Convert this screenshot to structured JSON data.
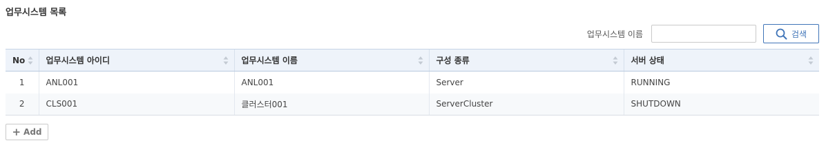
{
  "page": {
    "title": "업무시스템 목록"
  },
  "search": {
    "label": "업무시스템 이름",
    "value": "",
    "placeholder": "",
    "button_label": "검색",
    "button_icon": "search-icon"
  },
  "table": {
    "columns": [
      {
        "label": "No",
        "sort_icon": "sort-icon"
      },
      {
        "label": "업무시스템 아이디",
        "sort_icon": "sort-icon"
      },
      {
        "label": "업무시스템 이름",
        "sort_icon": "sort-icon"
      },
      {
        "label": "구성 종류",
        "sort_icon": "sort-icon"
      },
      {
        "label": "서버 상태",
        "sort_icon": "sort-icon"
      }
    ],
    "rows": [
      {
        "no": "1",
        "id": "ANL001",
        "name": "ANL001",
        "type": "Server",
        "status": "RUNNING"
      },
      {
        "no": "2",
        "id": "CLS001",
        "name": "클러스터001",
        "type": "ServerCluster",
        "status": "SHUTDOWN"
      }
    ]
  },
  "actions": {
    "add_label": "Add",
    "add_icon": "plus-icon"
  },
  "colors": {
    "accent": "#3f74b8",
    "header_bg": "#eef3fa",
    "alt_row_bg": "#f7f9fb"
  }
}
